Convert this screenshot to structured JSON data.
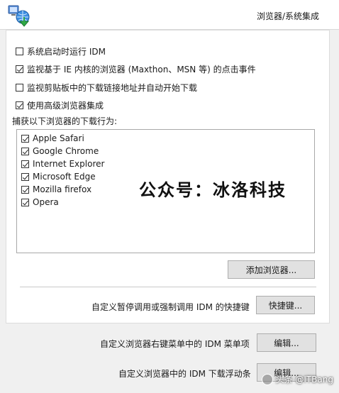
{
  "header": {
    "title": "浏览器/系统集成",
    "icon": "idm-network-icon"
  },
  "options": [
    {
      "label": "系统启动时运行 IDM",
      "checked": false
    },
    {
      "label": "监视基于 IE 内核的浏览器 (Maxthon、MSN 等) 的点击事件",
      "checked": true
    },
    {
      "label": "监视剪贴板中的下载链接地址并自动开始下载",
      "checked": false
    },
    {
      "label": "使用高级浏览器集成",
      "checked": true
    }
  ],
  "browser_group": {
    "label": "捕获以下浏览器的下载行为:",
    "items": [
      {
        "label": "Apple Safari",
        "checked": true
      },
      {
        "label": "Google Chrome",
        "checked": true
      },
      {
        "label": "Internet Explorer",
        "checked": true
      },
      {
        "label": "Microsoft Edge",
        "checked": true
      },
      {
        "label": "Mozilla firefox",
        "checked": true
      },
      {
        "label": "Opera",
        "checked": true
      }
    ],
    "add_button": "添加浏览器..."
  },
  "watermark_center": "公众号：冰洛科技",
  "hotkey": {
    "label": "自定义暂停调用或强制调用 IDM 的快捷键",
    "button": "快捷键..."
  },
  "context_menu": {
    "label": "自定义浏览器右键菜单中的 IDM 菜单项",
    "button": "编辑..."
  },
  "float_bar": {
    "label": "自定义浏览器中的 IDM 下载浮动条",
    "button": "编辑..."
  },
  "footer_watermark": "头条 @ITBang"
}
